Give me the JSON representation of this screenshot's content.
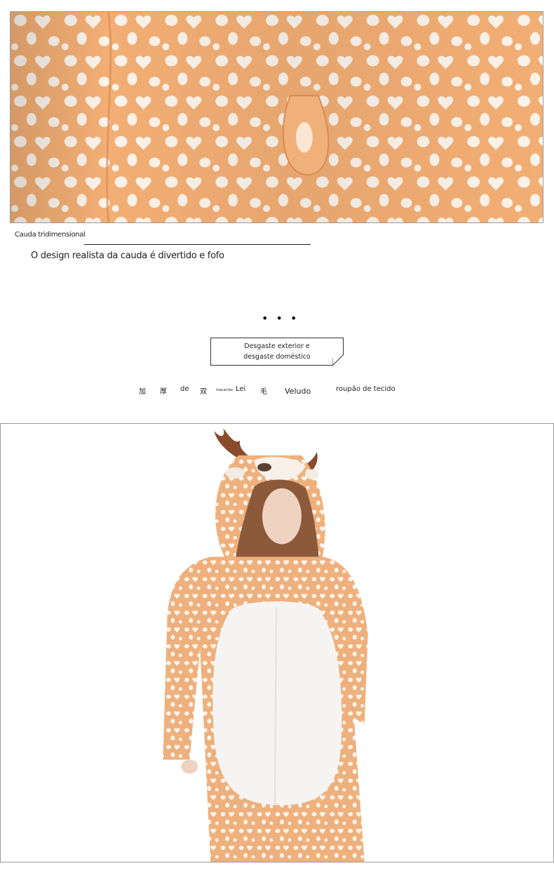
{
  "caption": {
    "title": "Cauda tridimensional",
    "text": "O design realista da cauda é divertido e fofo"
  },
  "divider_dots": "• • •",
  "tag": {
    "label": "Desgaste exterior e desgaste doméstico"
  },
  "features": {
    "items": [
      "加",
      "厚",
      "de",
      "双",
      "macarrão",
      "Lei",
      "毛",
      "Veludo",
      "roupão de tecido"
    ]
  },
  "colors": {
    "fabric_orange": "#f2b27a",
    "spot_white": "#fbf3ea",
    "belly_white": "#f5f4f2",
    "antler_brown": "#8a4a2c"
  }
}
